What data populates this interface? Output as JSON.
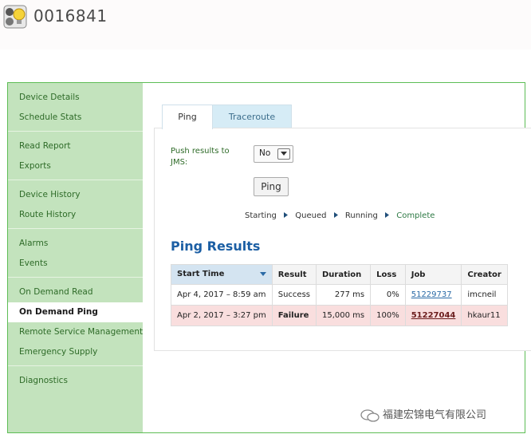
{
  "header": {
    "title": "0016841"
  },
  "sidebar": {
    "groups": [
      [
        "Device Details",
        "Schedule Stats"
      ],
      [
        "Read Report",
        "Exports"
      ],
      [
        "Device History",
        "Route History"
      ],
      [
        "Alarms",
        "Events"
      ],
      [
        "On Demand Read",
        "On Demand Ping",
        "Remote Service Management",
        "Emergency Supply"
      ],
      [
        "Diagnostics"
      ]
    ],
    "active": "On Demand Ping"
  },
  "tabs": {
    "ping": "Ping",
    "traceroute": "Traceroute",
    "active": "Ping"
  },
  "form": {
    "push_label": "Push results to JMS:",
    "push_value": "No",
    "ping_button": "Ping"
  },
  "steps": [
    "Starting",
    "Queued",
    "Running",
    "Complete"
  ],
  "results": {
    "title": "Ping Results",
    "columns": [
      "Start Time",
      "Result",
      "Duration",
      "Loss",
      "Job",
      "Creator"
    ],
    "rows": [
      {
        "start": "Apr 4, 2017 – 8:59 am",
        "result": "Success",
        "duration": "277 ms",
        "loss": "0%",
        "job": "51229737",
        "creator": "imcneil"
      },
      {
        "start": "Apr 2, 2017 – 3:27 pm",
        "result": "Failure",
        "duration": "15,000 ms",
        "loss": "100%",
        "job": "51227044",
        "creator": "hkaur11"
      }
    ]
  },
  "watermark": "福建宏锦电气有限公司"
}
